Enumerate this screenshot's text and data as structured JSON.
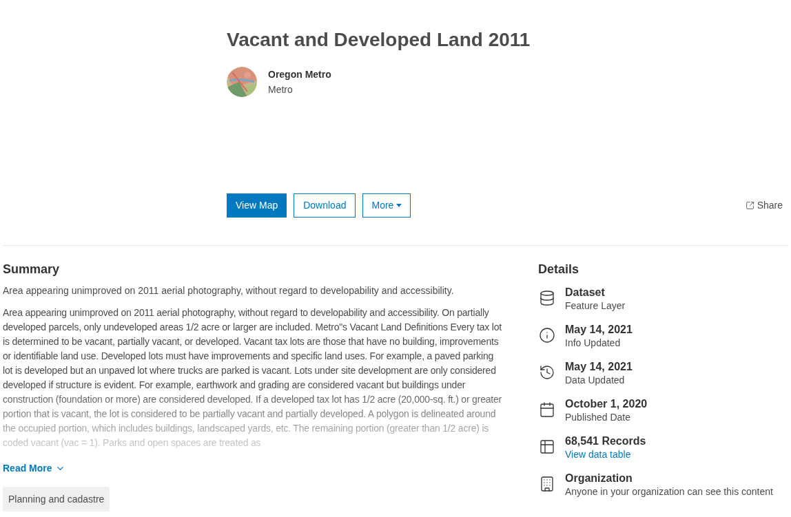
{
  "header": {
    "title": "Vacant and Developed Land 2011",
    "owner": {
      "name": "Oregon Metro",
      "org": "Metro"
    }
  },
  "actions": [
    {
      "label": "View Map",
      "kind": "primary"
    },
    {
      "label": "Download",
      "kind": "outline"
    },
    {
      "label": "More",
      "kind": "menu"
    }
  ],
  "share": {
    "label": "Share"
  },
  "summary": {
    "heading": "Summary",
    "snippet": "Area appearing unimproved on 2011 aerial photography, without regard to developability and accessibility.",
    "description": "Area appearing unimproved on 2011 aerial photography, without regard to developability and accessibility. On partially developed parcels, only undeveloped areas 1/2 acre or larger are included. Metro\"s Vacant Land Definitions Every tax lot is determined to be vacant, partially vacant, or developed. Vacant tax lots are those that have no building, improvements or identifiable land use. Developed lots must have improvements and specific land uses. For example, a paved parking lot is developed but an unpaved lot where trucks are parked is vacant. Lots under site development are only considered developed if structure is evident. For example, earthwork and grading are considered vacant but buildings under construction (foundation or more) are considered developed. If a developed tax lot has 1/2 acre (20,000-sq. ft.) or greater portion that is vacant, the lot is considered to be partially vacant and partially developed. A polygon is delineated around the occupied portion, which includes buildings, landscaped yards, etc. The remaining portion (greater than 1/2 acre) is coded vacant (vac = 1). Parks and open spaces are treated as",
    "read_more": "Read More",
    "tags": [
      "Planning and cadastre"
    ]
  },
  "details": {
    "heading": "Details",
    "items": [
      {
        "kind": "dataset",
        "title": "Dataset",
        "subtitle": "Feature Layer"
      },
      {
        "kind": "info",
        "title": "May 14, 2021",
        "subtitle": "Info Updated"
      },
      {
        "kind": "history",
        "title": "May 14, 2021",
        "subtitle": "Data Updated"
      },
      {
        "kind": "calendar",
        "title": "October 1, 2020",
        "subtitle": "Published Date"
      },
      {
        "kind": "records",
        "title": "68,541 Records",
        "link": "View data table"
      },
      {
        "kind": "organization",
        "title": "Organization",
        "subtitle": "Anyone in your organization can see this content"
      }
    ]
  }
}
